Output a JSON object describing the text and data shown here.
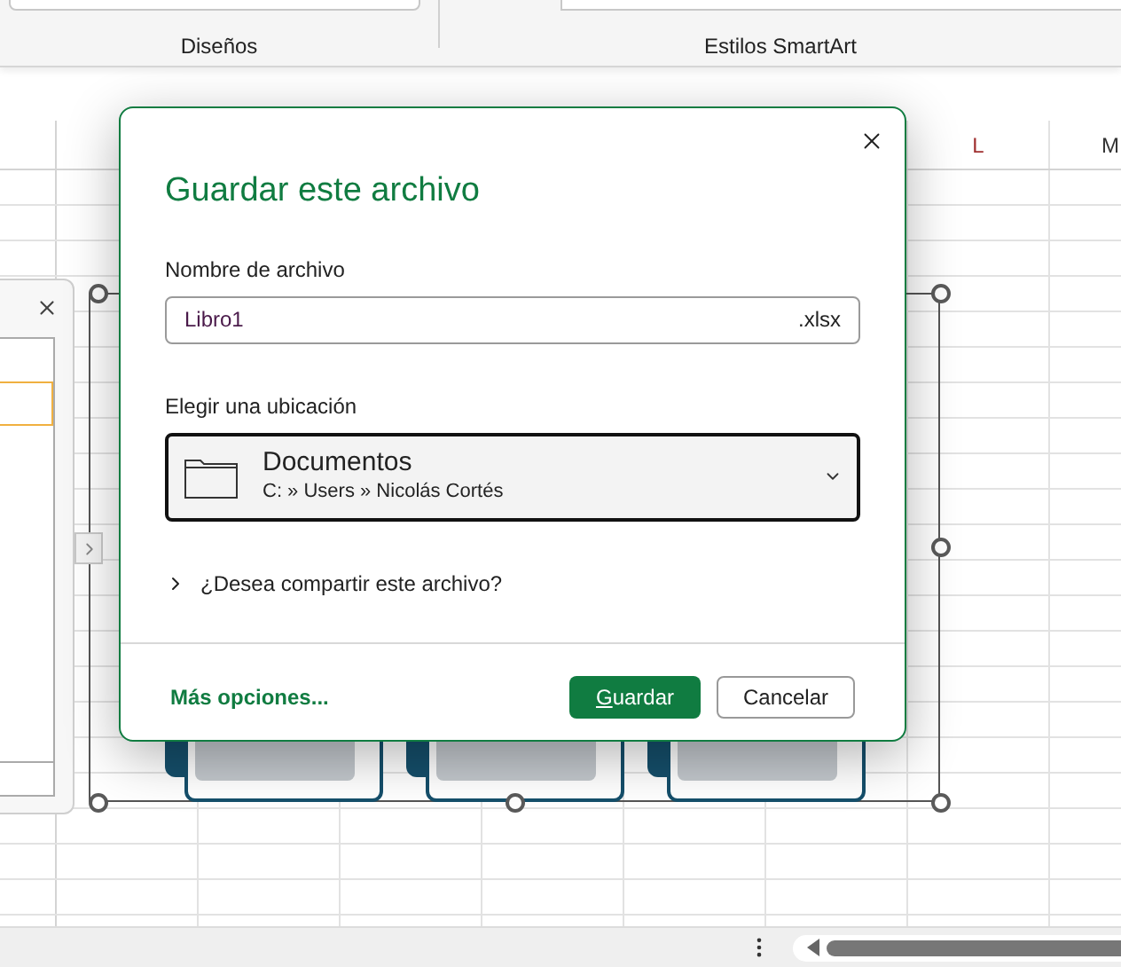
{
  "ribbon": {
    "groups": [
      {
        "label": "Diseños"
      },
      {
        "label": "Estilos SmartArt"
      }
    ]
  },
  "sheet": {
    "column_headers": [
      "L",
      "M"
    ],
    "smartart": {
      "shapes": [
        {
          "kind": "box"
        },
        {
          "kind": "box"
        },
        {
          "kind": "box"
        }
      ]
    }
  },
  "dialog": {
    "title": "Guardar este archivo",
    "file_name": {
      "label": "Nombre de archivo",
      "value": "Libro1",
      "extension": ".xlsx"
    },
    "location": {
      "label": "Elegir una ubicación",
      "folder": "Documentos",
      "path": "C: » Users » Nicolás Cortés"
    },
    "share": {
      "label": "¿Desea compartir este archivo?",
      "expanded": false
    },
    "more_options": "Más opciones...",
    "buttons": [
      {
        "label": "Guardar",
        "kind": "primary"
      },
      {
        "label": "Cancelar",
        "kind": "secondary"
      }
    ]
  }
}
